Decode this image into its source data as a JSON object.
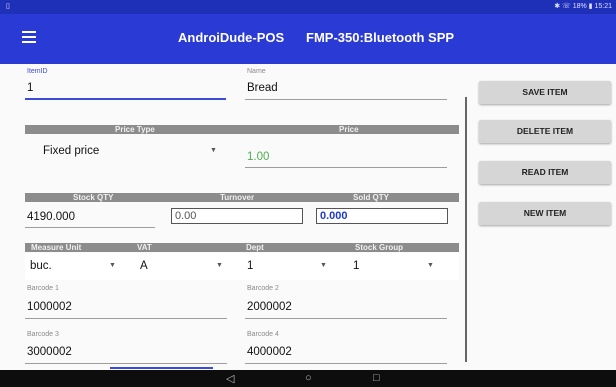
{
  "status_bar": {
    "right_text": "✱ ☏ 18% ▮ 15:21",
    "left_text": "▯"
  },
  "app_bar": {
    "title": "AndroiDude-POS",
    "subtitle": "FMP-350:Bluetooth SPP",
    "menu_icon": "hamburger-menu-icon"
  },
  "item": {
    "item_id_label": "ItemID",
    "item_id": "1",
    "name_label": "Name",
    "name": "Bread"
  },
  "price": {
    "header_type": "Price Type",
    "header_price": "Price",
    "type": "Fixed price",
    "value": "1.00",
    "value_color": "#4caf50"
  },
  "stock": {
    "header_qty": "Stock QTY",
    "header_turnover": "Turnover",
    "header_sold": "Sold QTY",
    "qty": "4190.000",
    "turnover": "0.00",
    "sold": "0.000"
  },
  "measure": {
    "header_unit": "Measure Unit",
    "header_vat": "VAT",
    "header_dept": "Dept",
    "header_group": "Stock Group",
    "unit": "buc.",
    "vat": "A",
    "dept": "1",
    "group": "1"
  },
  "barcodes": [
    {
      "label": "Barcode 1",
      "value": "1000002"
    },
    {
      "label": "Barcode 2",
      "value": "2000002"
    },
    {
      "label": "Barcode 3",
      "value": "3000002"
    },
    {
      "label": "Barcode 4",
      "value": "4000002"
    }
  ],
  "buttons": {
    "save": "SAVE ITEM",
    "delete": "DELETE ITEM",
    "read": "READ ITEM",
    "new": "NEW ITEM"
  },
  "nav": {
    "back": "◁",
    "home": "○",
    "recent": "□"
  },
  "colors": {
    "appbar": "#2a3ad4",
    "accent": "#3b4bd8",
    "price_value": "#4caf50"
  }
}
